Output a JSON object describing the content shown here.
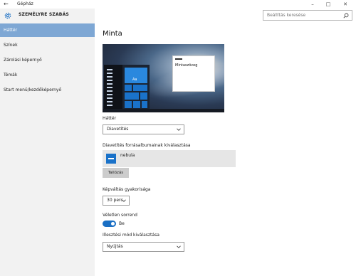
{
  "window": {
    "title": "Gépház"
  },
  "sidebar": {
    "title": "SZEMÉLYRE SZABÁS",
    "items": [
      {
        "label": "Háttér",
        "active": true
      },
      {
        "label": "Színek",
        "active": false
      },
      {
        "label": "Zárolási képernyő",
        "active": false
      },
      {
        "label": "Témák",
        "active": false
      },
      {
        "label": "Start menü/kezdőképernyő",
        "active": false
      }
    ]
  },
  "search": {
    "placeholder": "Beállítás keresése"
  },
  "main": {
    "heading": "Minta",
    "preview": {
      "tile_text": "Aa",
      "window_text": "Mintaszöveg"
    },
    "background": {
      "label": "Háttér",
      "value": "Diavetítés"
    },
    "slideshow": {
      "label": "Diavetítés forrásalbumainak kiválasztása",
      "album": "nebula",
      "browse_label": "Tallózás"
    },
    "frequency": {
      "label": "Képváltás gyakorisága",
      "value": "30 perc"
    },
    "shuffle": {
      "label": "Véletlen sorrend",
      "state_label": "Be",
      "on": true
    },
    "fit": {
      "label": "Illesztési mód kiválasztása",
      "value": "Nyújtás"
    }
  },
  "colors": {
    "accent": "#1a6fc4",
    "nav_active": "#7ea7d4",
    "sidebar_bg": "#f2f2f2"
  }
}
